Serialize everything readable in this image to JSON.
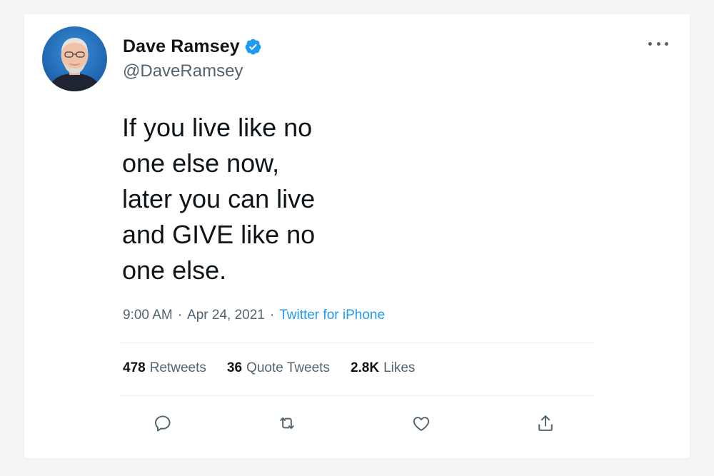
{
  "user": {
    "display_name": "Dave Ramsey",
    "handle": "@DaveRamsey",
    "verified": true,
    "avatar_icon": "profile-photo"
  },
  "tweet": {
    "text": "If you live like no\none else now,\nlater you can live\nand GIVE like no\none else.",
    "time": "9:00 AM",
    "date": "Apr 24, 2021",
    "separator": "·",
    "source": "Twitter for iPhone"
  },
  "stats": {
    "retweets": {
      "count": "478",
      "label": "Retweets"
    },
    "quote_tweets": {
      "count": "36",
      "label": "Quote Tweets"
    },
    "likes": {
      "count": "2.8K",
      "label": "Likes"
    }
  },
  "actions": [
    {
      "icon": "reply-icon"
    },
    {
      "icon": "retweet-icon"
    },
    {
      "icon": "like-icon"
    },
    {
      "icon": "share-icon"
    }
  ],
  "colors": {
    "accent": "#1d9bf0",
    "text_primary": "#0f1419",
    "text_secondary": "#536471",
    "page_background": "#f4f5f7",
    "card_background": "#ffffff"
  }
}
